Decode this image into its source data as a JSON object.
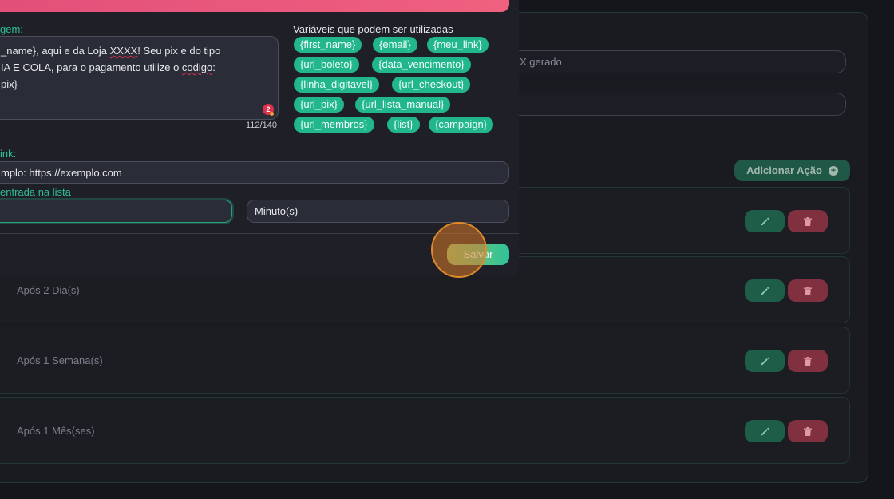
{
  "background": {
    "input_1_text": "X gerado",
    "input_2_text": "",
    "add_action_label": "Adicionar Ação",
    "actions": [
      {
        "label": ""
      },
      {
        "label": "Após 2 Dia(s)"
      },
      {
        "label": "Após 1 Semana(s)"
      },
      {
        "label": "Após 1 Mês(ses)"
      }
    ],
    "colors": {
      "edit": "#1e5d47",
      "delete": "#80303f",
      "accent": "#22b68c"
    }
  },
  "modal": {
    "message_label": "gem:",
    "message_lines": [
      [
        "_name}, aqui e da Loja ",
        "XXXX",
        "! Seu pix e do tipo"
      ],
      [
        "IA E COLA, para o pagamento utilize o ",
        "codigo",
        ":"
      ],
      [
        "pix}",
        "",
        ""
      ]
    ],
    "grammar_count": "2",
    "char_counter": "112/140",
    "variables_title": "Variáveis que podem ser utilizadas",
    "variables": [
      "{first_name}",
      "{email}",
      "{meu_link}",
      "{url_boleto}",
      "{data_vencimento}",
      "{linha_digitavel}",
      "{url_checkout}",
      "{url_pix}",
      "{url_lista_manual}",
      "{url_membros}",
      "{list}",
      "{campaign}"
    ],
    "link_label": "ink:",
    "link_placeholder": "mplo: https://exemplo.com",
    "entry_label": "entrada na lista",
    "delay_value": "",
    "unit_value": "Minuto(s)",
    "save_label": "Salvar"
  }
}
